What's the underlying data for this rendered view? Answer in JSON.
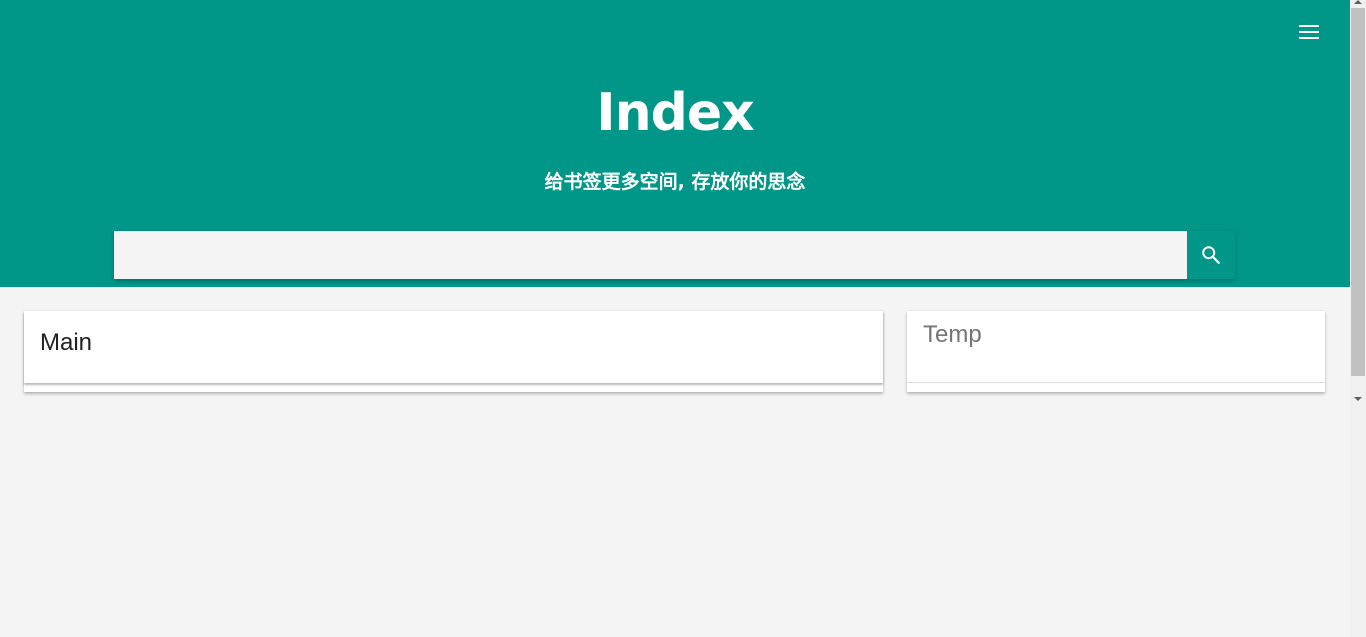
{
  "header": {
    "title": "Index",
    "subtitle": "给书签更多空间, 存放你的思念",
    "menu_icon": "menu-icon",
    "background_color": "#009688"
  },
  "search": {
    "value": "",
    "placeholder": "",
    "button_icon": "search-icon"
  },
  "cards": {
    "main": {
      "title": "Main"
    },
    "temp": {
      "title": "Temp"
    }
  },
  "colors": {
    "accent": "#009688",
    "page_background": "#f4f4f4",
    "card_background": "#ffffff"
  }
}
